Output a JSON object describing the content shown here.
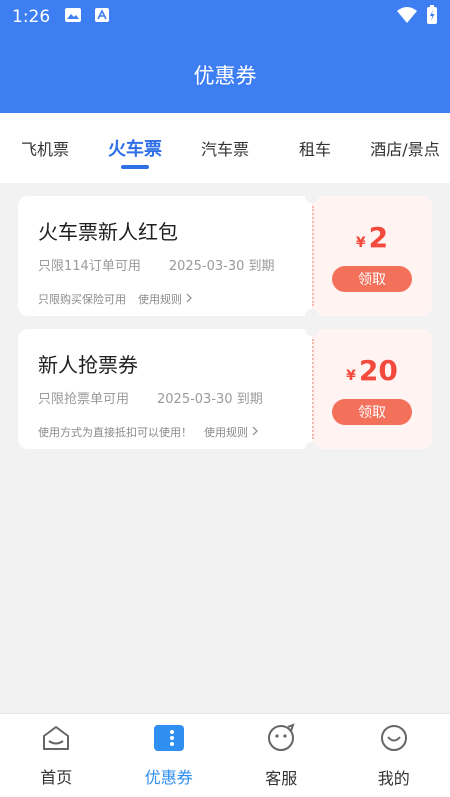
{
  "status": {
    "time": "1:26",
    "icons": [
      "image-icon",
      "a-box-icon",
      "wifi-icon",
      "battery-icon"
    ]
  },
  "header": {
    "title": "优惠券"
  },
  "tabs": [
    {
      "label": "飞机票"
    },
    {
      "label": "火车票"
    },
    {
      "label": "汽车票"
    },
    {
      "label": "租车"
    },
    {
      "label": "酒店/景点"
    }
  ],
  "active_tab": "火车票",
  "coupons": [
    {
      "title": "火车票新人红包",
      "condition": "只限114订单可用",
      "expiry": "2025-03-30 到期",
      "note": "只限购买保险可用",
      "rule_label": "使用规则",
      "currency": "¥",
      "amount": "2",
      "button_label": "领取"
    },
    {
      "title": "新人抢票券",
      "condition": "只限抢票单可用",
      "expiry": "2025-03-30 到期",
      "note": "使用方式为直接抵扣可以使用！",
      "rule_label": "使用规则",
      "currency": "¥",
      "amount": "20",
      "button_label": "领取"
    }
  ],
  "bottom_nav": [
    {
      "label": "首页",
      "icon": "home-icon"
    },
    {
      "label": "优惠券",
      "icon": "coupon-icon"
    },
    {
      "label": "客服",
      "icon": "service-icon"
    },
    {
      "label": "我的",
      "icon": "profile-icon"
    }
  ],
  "colors": {
    "primary": "#3e7ef3",
    "tab_active": "#2f6fe8",
    "amount": "#f34a3d",
    "claim_button": "#f3705b",
    "nav_active": "#2f8ff0"
  }
}
